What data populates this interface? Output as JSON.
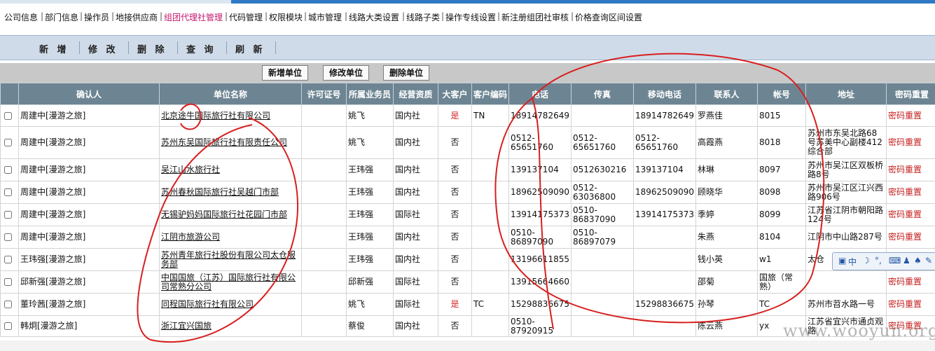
{
  "topnav": [
    "公司信息",
    "部门信息",
    "操作员",
    "地接供应商",
    "组团代理社管理",
    "代码管理",
    "权限模块",
    "城市管理",
    "线路大类设置",
    "线路子类",
    "操作专线设置",
    "新注册组团社审核",
    "价格查询区间设置"
  ],
  "toolbar": {
    "add": "新 增",
    "edit": "修 改",
    "delete": "删 除",
    "query": "查 询",
    "refresh": "刷 新"
  },
  "unit_buttons": {
    "add": "新增单位",
    "edit": "修改单位",
    "delete": "删除单位"
  },
  "columns": [
    "确认人",
    "单位名称",
    "许可证号",
    "所属业务员",
    "经营资质",
    "大客户",
    "客户编码",
    "电话",
    "传真",
    "移动电话",
    "联系人",
    "帐号",
    "地址",
    "密码重置"
  ],
  "rows": [
    {
      "confirmer": "周建中[漫游之旅]",
      "unit": "北京途牛国际旅行社有限公司",
      "license": "",
      "salesman": "姚飞",
      "qualification": "国内社",
      "vip": "是",
      "code": "TN",
      "phone": "18914782649",
      "fax": "",
      "mobile": "18914782649",
      "contact": "罗燕佳",
      "account": "8015",
      "address": "",
      "reset": "密码重置"
    },
    {
      "confirmer": "周建中[漫游之旅]",
      "unit": "苏州东吴国际旅行社有限责任公司",
      "license": "",
      "salesman": "姚飞",
      "qualification": "国内社",
      "vip": "否",
      "code": "",
      "phone": "0512-65651760",
      "fax": "0512-65651760",
      "mobile": "0512-65651760",
      "contact": "高霞燕",
      "account": "8018",
      "address": "苏州市东吴北路68号苏美中心副楼412综合部",
      "reset": "密码重置"
    },
    {
      "confirmer": "周建中[漫游之旅]",
      "unit": "吴江山水旅行社",
      "license": "",
      "salesman": "王玮强",
      "qualification": "国内社",
      "vip": "否",
      "code": "",
      "phone": "139137104",
      "fax": "0512630216",
      "mobile": "139137104",
      "contact": "林琳",
      "account": "8097",
      "address": "苏州市吴江区双板桥路8号",
      "reset": "密码重置"
    },
    {
      "confirmer": "周建中[漫游之旅]",
      "unit": "苏州春秋国际旅行社吴越门市部",
      "license": "",
      "salesman": "王玮强",
      "qualification": "国内社",
      "vip": "否",
      "code": "",
      "phone": "18962509090",
      "fax": "0512-63036800",
      "mobile": "18962509090",
      "contact": "顾晓华",
      "account": "8098",
      "address": "苏州市吴江区江兴西路906号",
      "reset": "密码重置"
    },
    {
      "confirmer": "周建中[漫游之旅]",
      "unit": "无锡驴妈妈国际旅行社花园门市部",
      "license": "",
      "salesman": "王玮强",
      "qualification": "国际社",
      "vip": "否",
      "code": "",
      "phone": "13914175373",
      "fax": "0510-86837090",
      "mobile": "13914175373",
      "contact": "季婷",
      "account": "8099",
      "address": "江苏省江阴市朝阳路124号",
      "reset": "密码重置"
    },
    {
      "confirmer": "周建中[漫游之旅]",
      "unit": "江阴市旅游公司",
      "license": "",
      "salesman": "王玮强",
      "qualification": "国内社",
      "vip": "否",
      "code": "",
      "phone": "0510-86897090",
      "fax": "0510-86897079",
      "mobile": "",
      "contact": "朱燕",
      "account": "8104",
      "address": "江阴市中山路287号",
      "reset": "密码重置"
    },
    {
      "confirmer": "王玮强[漫游之旅]",
      "unit": "苏州青年旅行社股份有限公司太仓服务部",
      "license": "",
      "salesman": "王玮强",
      "qualification": "国内社",
      "vip": "否",
      "code": "",
      "phone": "13196611855",
      "fax": "",
      "mobile": "",
      "contact": "钱小英",
      "account": "w1",
      "address": "太仓",
      "reset": "密码重置"
    },
    {
      "confirmer": "邱新强[漫游之旅]",
      "unit": "中国国旅（江苏）国际旅行社有限公司常熟分公司",
      "license": "",
      "salesman": "邱新强",
      "qualification": "国际社",
      "vip": "否",
      "code": "",
      "phone": "13915664660",
      "fax": "",
      "mobile": "",
      "contact": "邵菊",
      "account": "国旅（常熟）",
      "address": "",
      "reset": "密码重置"
    },
    {
      "confirmer": "董玲茜[漫游之旅]",
      "unit": "同程国际旅行社有限公司",
      "license": "",
      "salesman": "姚飞",
      "qualification": "国际社",
      "vip": "是",
      "code": "TC",
      "phone": "15298836675",
      "fax": "",
      "mobile": "15298836675",
      "contact": "孙琴",
      "account": "TC",
      "address": "苏州市苕水路一号",
      "reset": "密码重置"
    },
    {
      "confirmer": "韩炯[漫游之旅]",
      "unit": "浙江宜兴国旅",
      "license": "",
      "salesman": "蔡俊",
      "qualification": "国内社",
      "vip": "否",
      "code": "",
      "phone": "0510-87920915",
      "fax": "",
      "mobile": "",
      "contact": "陈云燕",
      "account": "yx",
      "address": "江苏省宜兴市通贞观路",
      "reset": "密码重置"
    }
  ],
  "ime_toolbar": {
    "label": "中"
  },
  "watermark": "www.wooyun.org",
  "colors": {
    "header_bg": "#6d8593",
    "toolbar_bg": "#cfdbe8",
    "accent_nav": "#c2186b",
    "reset_link": "#c41e1e",
    "annotation": "#d81f1f"
  }
}
